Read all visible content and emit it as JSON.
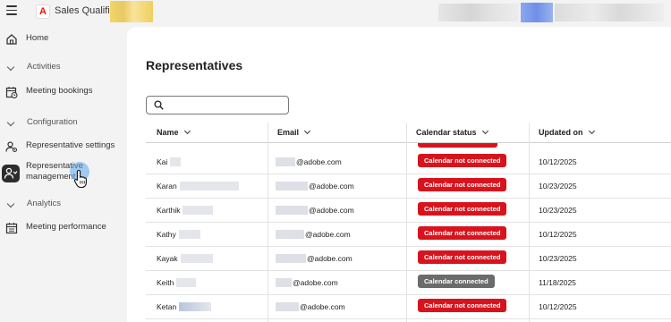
{
  "header": {
    "app_name": "Sales Qualifier",
    "logo_letter": "A",
    "brand_color": "#eb1000"
  },
  "sidebar": {
    "items": [
      {
        "type": "item",
        "label": "Home",
        "icon": "home-icon"
      },
      {
        "type": "section",
        "label": "Activities"
      },
      {
        "type": "item",
        "label": "Meeting bookings",
        "icon": "calendar-clock-icon"
      },
      {
        "type": "section",
        "label": "Configuration"
      },
      {
        "type": "item",
        "label": "Representative settings",
        "icon": "user-gear-icon"
      },
      {
        "type": "item",
        "label": "Representative management",
        "icon": "user-manage-icon",
        "selected": true
      },
      {
        "type": "section",
        "label": "Analytics"
      },
      {
        "type": "item",
        "label": "Meeting performance",
        "icon": "calendar-chart-icon"
      }
    ]
  },
  "main": {
    "title": "Representatives",
    "search": {
      "placeholder": "",
      "value": ""
    },
    "columns": [
      "Name",
      "Email",
      "Calendar status",
      "Updated on"
    ],
    "rows": [
      {
        "name": "Kai",
        "email": "@adobe.com",
        "status": "Calendar not connected",
        "connected": false,
        "updated": "10/12/2025"
      },
      {
        "name": "Karan",
        "email": "@adobe.com",
        "status": "Calendar not connected",
        "connected": false,
        "updated": "10/23/2025"
      },
      {
        "name": "Karthik",
        "email": "@adobe.com",
        "status": "Calendar not connected",
        "connected": false,
        "updated": "10/23/2025"
      },
      {
        "name": "Kathy",
        "email": "@adobe.com",
        "status": "Calendar not connected",
        "connected": false,
        "updated": "10/12/2025"
      },
      {
        "name": "Kayak",
        "email": "@adobe.com",
        "status": "Calendar not connected",
        "connected": false,
        "updated": "10/23/2025"
      },
      {
        "name": "Keith",
        "email": "@adobe.com",
        "status": "Calendar connected",
        "connected": true,
        "updated": "11/18/2025"
      },
      {
        "name": "Ketan",
        "email": "@adobe.com",
        "status": "Calendar not connected",
        "connected": false,
        "updated": "10/12/2025"
      }
    ]
  },
  "colors": {
    "not_connected": "#d7141d",
    "connected": "#6b6b6b",
    "cursor_halo": "#5fa5eb"
  }
}
